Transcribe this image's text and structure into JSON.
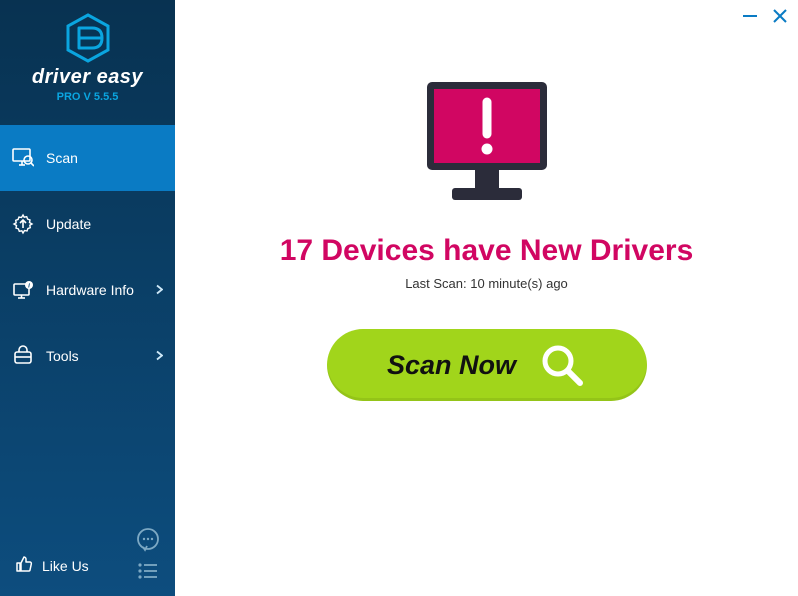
{
  "brand": "driver easy",
  "version": "PRO V 5.5.5",
  "nav": {
    "scan": "Scan",
    "update": "Update",
    "hardware": "Hardware Info",
    "tools": "Tools"
  },
  "footer": {
    "like": "Like Us"
  },
  "main": {
    "headline": "17 Devices have New Drivers",
    "subline": "Last Scan: 10 minute(s) ago",
    "scanBtn": "Scan Now"
  }
}
